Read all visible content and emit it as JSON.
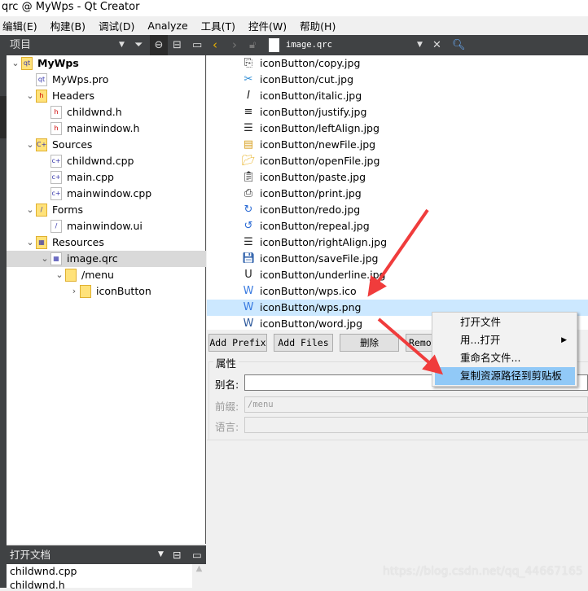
{
  "window": {
    "title": "qrc @ MyWps - Qt Creator"
  },
  "menu": [
    "编辑(E)",
    "构建(B)",
    "调试(D)",
    "Analyze",
    "工具(T)",
    "控件(W)",
    "帮助(H)"
  ],
  "toolbar": {
    "project_selector": "项目",
    "open_file": "image.qrc"
  },
  "tree": [
    {
      "label": "MyWps",
      "depth": 0,
      "expanded": true,
      "bold": true,
      "icon": "qt-project-icon"
    },
    {
      "label": "MyWps.pro",
      "depth": 1,
      "icon": "pro-file-icon"
    },
    {
      "label": "Headers",
      "depth": 1,
      "expanded": true,
      "icon": "headers-folder-icon"
    },
    {
      "label": "childwnd.h",
      "depth": 2,
      "icon": "header-file-icon"
    },
    {
      "label": "mainwindow.h",
      "depth": 2,
      "icon": "header-file-icon"
    },
    {
      "label": "Sources",
      "depth": 1,
      "expanded": true,
      "icon": "sources-folder-icon"
    },
    {
      "label": "childwnd.cpp",
      "depth": 2,
      "icon": "cpp-file-icon"
    },
    {
      "label": "main.cpp",
      "depth": 2,
      "icon": "cpp-file-icon"
    },
    {
      "label": "mainwindow.cpp",
      "depth": 2,
      "icon": "cpp-file-icon"
    },
    {
      "label": "Forms",
      "depth": 1,
      "expanded": true,
      "icon": "forms-folder-icon"
    },
    {
      "label": "mainwindow.ui",
      "depth": 2,
      "icon": "ui-file-icon"
    },
    {
      "label": "Resources",
      "depth": 1,
      "expanded": true,
      "icon": "resources-folder-icon"
    },
    {
      "label": "image.qrc",
      "depth": 2,
      "expanded": true,
      "selected": true,
      "icon": "qrc-file-icon"
    },
    {
      "label": "/menu",
      "depth": 3,
      "expanded": true,
      "icon": "folder-icon"
    },
    {
      "label": "iconButton",
      "depth": 4,
      "expanded": false,
      "icon": "folder-icon"
    }
  ],
  "open_docs": {
    "title": "打开文档",
    "items": [
      "childwnd.cpp",
      "childwnd.h"
    ]
  },
  "files": [
    {
      "label": "iconButton/copy.jpg",
      "icon": "copy-icon"
    },
    {
      "label": "iconButton/cut.jpg",
      "icon": "scissors-icon"
    },
    {
      "label": "iconButton/italic.jpg",
      "icon": "italic-icon"
    },
    {
      "label": "iconButton/justify.jpg",
      "icon": "justify-icon"
    },
    {
      "label": "iconButton/leftAlign.jpg",
      "icon": "align-left-icon"
    },
    {
      "label": "iconButton/newFile.jpg",
      "icon": "new-file-icon"
    },
    {
      "label": "iconButton/openFile.jpg",
      "icon": "open-folder-icon"
    },
    {
      "label": "iconButton/paste.jpg",
      "icon": "paste-icon"
    },
    {
      "label": "iconButton/print.jpg",
      "icon": "printer-icon"
    },
    {
      "label": "iconButton/redo.jpg",
      "icon": "redo-icon"
    },
    {
      "label": "iconButton/repeal.jpg",
      "icon": "undo-icon"
    },
    {
      "label": "iconButton/rightAlign.jpg",
      "icon": "align-right-icon"
    },
    {
      "label": "iconButton/saveFile.jpg",
      "icon": "save-icon"
    },
    {
      "label": "iconButton/underline.jpg",
      "icon": "underline-icon"
    },
    {
      "label": "iconButton/wps.ico",
      "icon": "wps-icon"
    },
    {
      "label": "iconButton/wps.png",
      "icon": "wps-icon",
      "selected": true
    },
    {
      "label": "iconButton/word.jpg",
      "icon": "word-icon"
    }
  ],
  "buttons": {
    "add_prefix": "Add Prefix",
    "add_files": "Add Files",
    "delete": "删除",
    "remove": "Remove"
  },
  "properties": {
    "title": "属性",
    "alias_label": "别名:",
    "alias_value": "",
    "prefix_label": "前缀:",
    "prefix_value": "/menu",
    "lang_label": "语言:",
    "lang_value": ""
  },
  "context_menu": {
    "items": [
      "打开文件",
      "用...打开",
      "重命名文件...",
      "复制资源路径到剪贴板"
    ],
    "highlighted": 3
  },
  "watermark": "https://blog.csdn.net/qq_44667165",
  "colors": {
    "dark": "#404244",
    "selection": "#cce8ff",
    "menu_highlight": "#91c9f7",
    "arrow": "#f03c3c"
  }
}
